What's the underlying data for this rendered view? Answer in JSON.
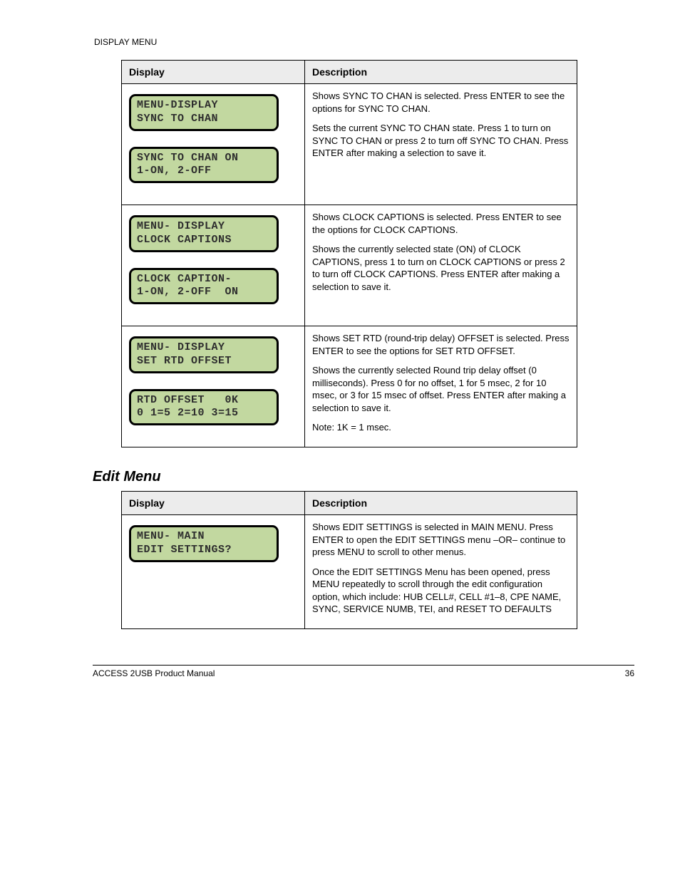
{
  "running_head": "DISPLAY MENU",
  "table1": {
    "headers": [
      "Display",
      "Description"
    ],
    "rows": [
      {
        "lcd1": "MENU-DISPLAY\nSYNC TO CHAN",
        "lcd2": "SYNC TO CHAN ON\n1-ON, 2-OFF",
        "desc": [
          "Shows SYNC TO CHAN is selected. Press ENTER to see the options for SYNC TO CHAN.",
          "Sets the current SYNC TO CHAN state. Press 1 to turn on SYNC TO CHAN or press 2 to turn off SYNC TO CHAN. Press ENTER after making a selection to save it."
        ]
      },
      {
        "lcd1": "MENU- DISPLAY\nCLOCK CAPTIONS",
        "lcd2": "CLOCK CAPTION-\n1-ON, 2-OFF  ON",
        "desc": [
          "Shows CLOCK CAPTIONS is selected. Press ENTER to see the options for CLOCK CAPTIONS.",
          "Shows the currently selected state (ON) of CLOCK CAPTIONS, press 1 to turn on CLOCK CAPTIONS or press 2 to turn off CLOCK CAPTIONS. Press ENTER after making a selection to save it."
        ]
      },
      {
        "lcd1": "MENU- DISPLAY\nSET RTD OFFSET",
        "lcd2": "RTD OFFSET   0K\n0 1=5 2=10 3=15",
        "desc": [
          "Shows SET RTD (round-trip delay) OFFSET is selected. Press ENTER to see the options for SET RTD OFFSET.",
          "Shows the currently selected Round trip delay offset (0 milliseconds). Press 0 for no offset, 1 for 5 msec, 2 for 10 msec, or 3 for 15 msec of offset. Press ENTER after making a selection to save it.",
          "Note: 1K = 1 msec."
        ]
      }
    ]
  },
  "edits_heading": "Edit Menu",
  "table2": {
    "headers": [
      "Display",
      "Description"
    ],
    "rows": [
      {
        "lcd1": "MENU- MAIN\nEDIT SETTINGS?",
        "desc": [
          "Shows EDIT SETTINGS is selected in MAIN MENU. Press ENTER to open the EDIT SETTINGS menu –OR– continue to press MENU to scroll to other menus.",
          "Once the EDIT SETTINGS Menu has been opened, press MENU repeatedly to scroll through the edit configuration option, which include: HUB CELL#, CELL #1–8, CPE NAME, SYNC, SERVICE NUMB, TEI, and RESET TO DEFAULTS"
        ]
      }
    ]
  },
  "footer": {
    "left": "ACCESS 2USB Product Manual",
    "right": "36"
  }
}
